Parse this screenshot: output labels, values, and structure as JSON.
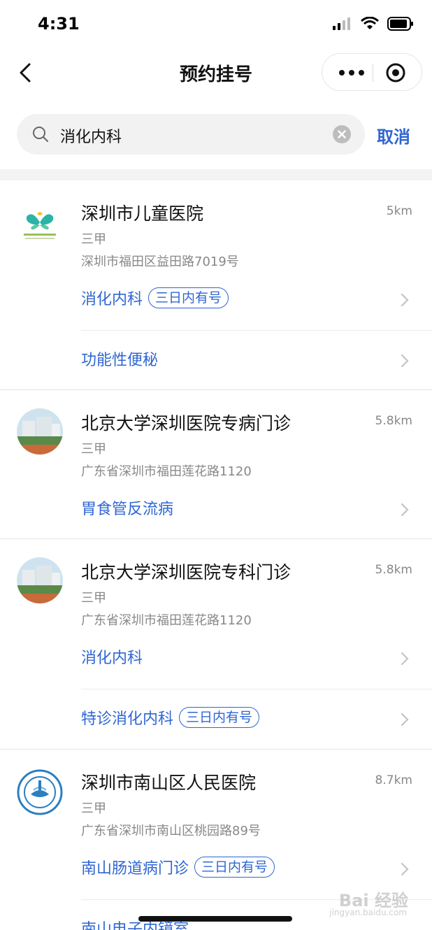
{
  "status_bar": {
    "time": "4:31"
  },
  "nav": {
    "title": "预约挂号"
  },
  "search": {
    "query": "消化内科",
    "cancel_label": "取消"
  },
  "hospitals": [
    {
      "name": "深圳市儿童医院",
      "distance": "5km",
      "level": "三甲",
      "address": "深圳市福田区益田路7019号",
      "logo_icon": "butterfly-logo-icon",
      "departments": [
        {
          "label": "消化内科",
          "badge": "三日内有号"
        },
        {
          "label": "功能性便秘",
          "badge": ""
        }
      ]
    },
    {
      "name": "北京大学深圳医院专病门诊",
      "distance": "5.8km",
      "level": "三甲",
      "address": "广东省深圳市福田莲花路1120",
      "logo_icon": "hospital-building-photo-icon",
      "departments": [
        {
          "label": "胃食管反流病",
          "badge": ""
        }
      ]
    },
    {
      "name": "北京大学深圳医院专科门诊",
      "distance": "5.8km",
      "level": "三甲",
      "address": "广东省深圳市福田莲花路1120",
      "logo_icon": "hospital-building-photo-icon",
      "departments": [
        {
          "label": "消化内科",
          "badge": ""
        },
        {
          "label": "特诊消化内科",
          "badge": "三日内有号"
        }
      ]
    },
    {
      "name": "深圳市南山区人民医院",
      "distance": "8.7km",
      "level": "三甲",
      "address": "广东省深圳市南山区桃园路89号",
      "logo_icon": "nanshan-hospital-emblem-icon",
      "departments": [
        {
          "label": "南山肠道病门诊",
          "badge": "三日内有号"
        },
        {
          "label": "南山电子内镜室",
          "badge": ""
        }
      ]
    }
  ],
  "watermark": {
    "text": "Bai 经验",
    "sub": "jingyan.baidu.com"
  },
  "colors": {
    "accent": "#2f66d2",
    "secondary_text": "#888888"
  }
}
